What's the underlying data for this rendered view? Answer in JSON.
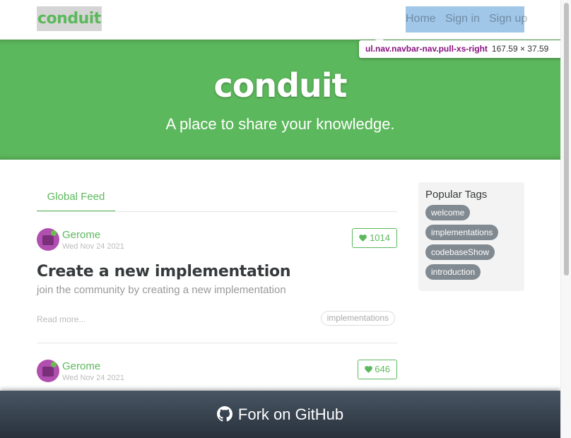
{
  "brand": "conduit",
  "nav": {
    "items": [
      "Home",
      "Sign in",
      "Sign up"
    ]
  },
  "inspector": {
    "selector": "ul.nav.navbar-nav.pull-xs-right",
    "size": "167.59 × 37.59"
  },
  "banner": {
    "title": "conduit",
    "subtitle": "A place to share your knowledge."
  },
  "feed": {
    "tab": "Global Feed"
  },
  "articles": [
    {
      "author": "Gerome",
      "date": "Wed Nov 24 2021",
      "likes": "1014",
      "title": "Create a new implementation",
      "description": "join the community by creating a new implementation",
      "read_more": "Read more...",
      "tag": "implementations"
    },
    {
      "author": "Gerome",
      "date": "Wed Nov 24 2021",
      "likes": "646"
    }
  ],
  "sidebar": {
    "title": "Popular Tags",
    "tags": [
      "welcome",
      "implementations",
      "codebaseShow",
      "introduction"
    ]
  },
  "footer": {
    "text": "Fork on GitHub"
  },
  "colors": {
    "accent": "#5cb85c",
    "tag_bg": "#818a91",
    "footer_dark": "#29323c"
  },
  "icons": {
    "like": "heart-icon",
    "github": "github-icon"
  }
}
